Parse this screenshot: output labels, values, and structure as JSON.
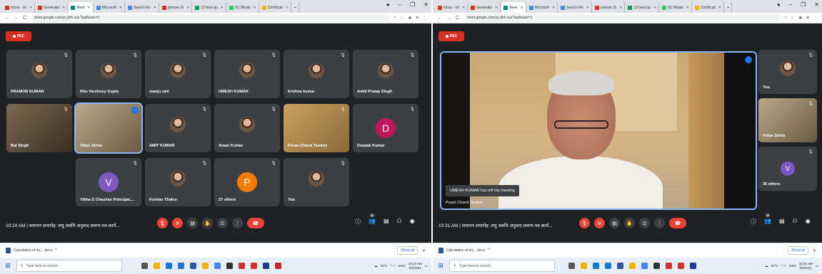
{
  "left": {
    "tabs": [
      {
        "label": "Inbox - ch",
        "color": "#d93025"
      },
      {
        "label": "Generatio",
        "color": "#d93025"
      },
      {
        "label": "Meet",
        "color": "#00897b",
        "active": true
      },
      {
        "label": "Microsoft",
        "color": "#4285f4"
      },
      {
        "label": "Search Re",
        "color": "#4285f4"
      },
      {
        "label": "pooran ch",
        "color": "#d93025"
      },
      {
        "label": "12 best qu",
        "color": "#0f9d58"
      },
      {
        "label": "(0) Whats",
        "color": "#25d366"
      },
      {
        "label": "Certificati",
        "color": "#f4b400"
      }
    ],
    "url": "meet.google.com/yy-jfvh-suz?authuser=1",
    "rec": "REC",
    "tiles": [
      {
        "name": "PRAMOD KUMAR"
      },
      {
        "name": "Ritu Varshney Gupta"
      },
      {
        "name": "manju rani"
      },
      {
        "name": "UMESH KUMAR"
      },
      {
        "name": "krishna kumar"
      },
      {
        "name": "Ankit Pratap Singh"
      },
      {
        "name": "Bal Singh"
      },
      {
        "name": "Vidya Sinha"
      },
      {
        "name": "AMIT KUMAR"
      },
      {
        "name": "Aman Kumar"
      },
      {
        "name": "Puran Chand Tandon"
      },
      {
        "name": "Deepak Kumar",
        "letter": "D",
        "color": "#c2185b"
      },
      {
        "name": "Vibha S Chauhan Principal,...",
        "letter": "V",
        "color": "#7e57c2"
      },
      {
        "name": "Keshav Thakur"
      },
      {
        "name": "27 others",
        "letter": "P",
        "color": "#f57c00"
      },
      {
        "name": "You"
      }
    ],
    "meeting": "10:24 AM  |  समापन समारोह: लघु अवधि अनुवाद प्रमाण-पत्र कार्य...",
    "people_count": "42",
    "download_file": "Calculation of inc....docx",
    "show_all": "Show all",
    "search_placeholder": "Type here to search",
    "tray_temp": "31°C",
    "tray_lang": "ENG",
    "time": "10:24 AM",
    "date": "8/4/2021"
  },
  "right": {
    "url": "meet.google.com/yy-jfvh-suz?authuser=1",
    "rec": "REC",
    "toast": "UMESH KUMAR has left the meeting",
    "speaker": "Puran Chand Tandon",
    "side": [
      {
        "name": "You"
      },
      {
        "name": "Vidya Sinha"
      },
      {
        "name": "36 others",
        "letter": "V",
        "color": "#7e57c2"
      }
    ],
    "meeting": "10:31 AM  |  समापन समारोह: लघु अवधि अनुवाद प्रमाण-पत्र कार्य...",
    "people_count": "39",
    "download_file": "Calculation of inc....docx",
    "show_all": "Show all",
    "search_placeholder": "Type here to search",
    "tray_temp": "31°C",
    "tray_lang": "ENG",
    "time": "10:31 AM",
    "date": "8/4/2021"
  }
}
